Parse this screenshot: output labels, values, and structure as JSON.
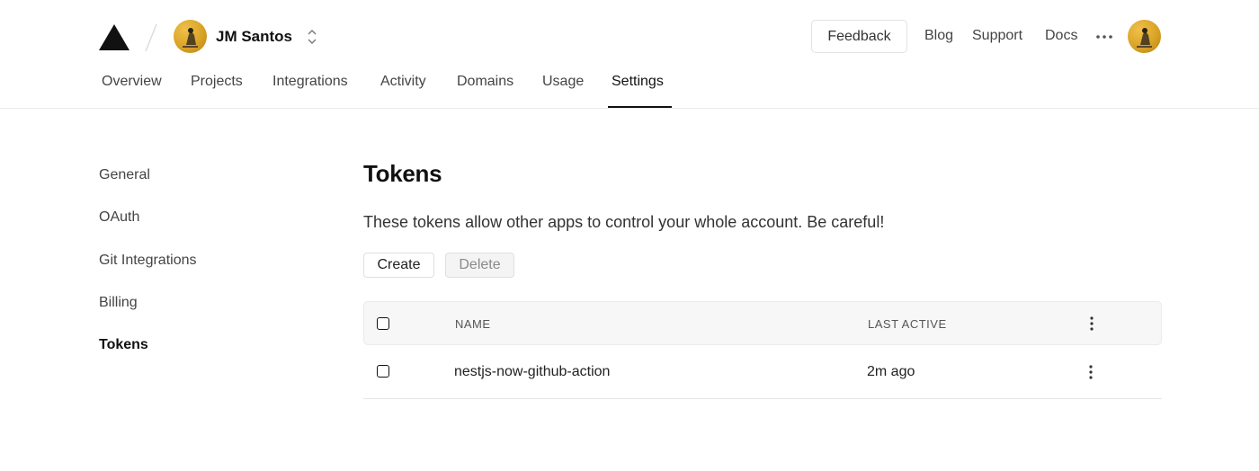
{
  "header": {
    "team_name": "JM Santos",
    "feedback_label": "Feedback",
    "links": {
      "blog": "Blog",
      "support": "Support",
      "docs": "Docs"
    }
  },
  "tabs": [
    {
      "label": "Overview"
    },
    {
      "label": "Projects"
    },
    {
      "label": "Integrations"
    },
    {
      "label": "Activity"
    },
    {
      "label": "Domains"
    },
    {
      "label": "Usage"
    },
    {
      "label": "Settings",
      "active": true
    }
  ],
  "sidebar": {
    "items": [
      {
        "label": "General"
      },
      {
        "label": "OAuth"
      },
      {
        "label": "Git Integrations"
      },
      {
        "label": "Billing"
      },
      {
        "label": "Tokens",
        "active": true
      }
    ]
  },
  "main": {
    "title": "Tokens",
    "description": "These tokens allow other apps to control your whole account. Be careful!",
    "create_label": "Create",
    "delete_label": "Delete",
    "table": {
      "columns": {
        "name": "NAME",
        "last_active": "LAST ACTIVE"
      },
      "rows": [
        {
          "name": "nestjs-now-github-action",
          "last_active": "2m ago"
        }
      ]
    }
  },
  "colors": {
    "accent": "#111111",
    "avatar": "#d9a326",
    "border": "#eaeaea"
  }
}
